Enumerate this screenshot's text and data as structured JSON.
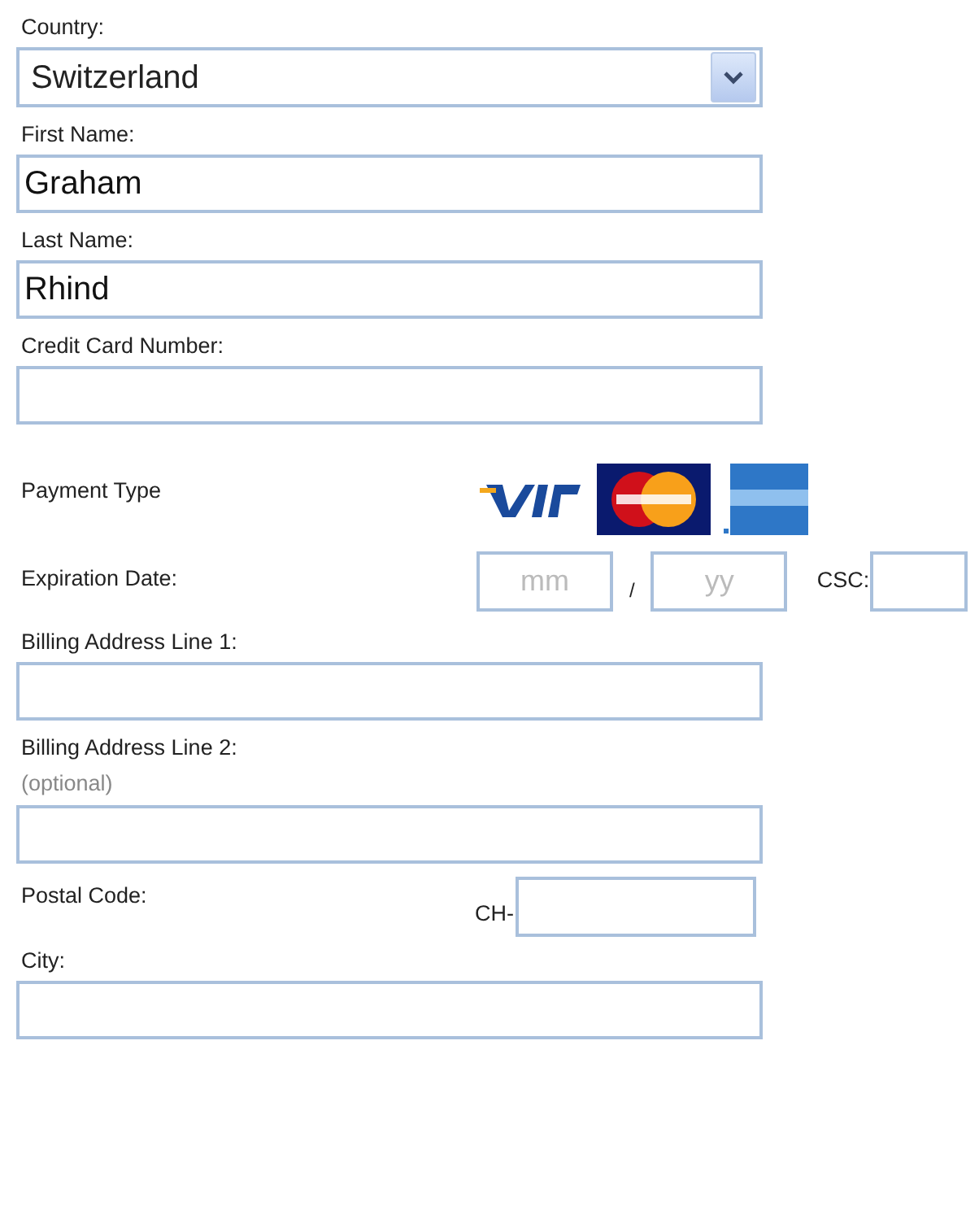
{
  "fields": [
    {
      "kind": "select",
      "label": "Country:",
      "value": "Switzerland"
    },
    {
      "kind": "text",
      "label": "First Name:",
      "value": "Graham"
    },
    {
      "kind": "text",
      "label": "Last Name:",
      "value": "Rhind"
    },
    {
      "kind": "text",
      "label": "Credit Card Number:"
    },
    {
      "kind": "cards",
      "label": "Payment Type"
    },
    {
      "kind": "expiry",
      "label": "Expiration Date:",
      "month_placeholder": "mm",
      "separator": "/",
      "year_placeholder": "yy",
      "csc_label": "CSC:"
    },
    {
      "kind": "text",
      "label": "Billing Address Line 1:"
    },
    {
      "kind": "text",
      "label": "Billing Address Line 2:",
      "hint": "(optional)"
    },
    {
      "kind": "postal",
      "label": "Postal Code:",
      "prefix": "CH-"
    },
    {
      "kind": "text",
      "label": "City:"
    }
  ]
}
